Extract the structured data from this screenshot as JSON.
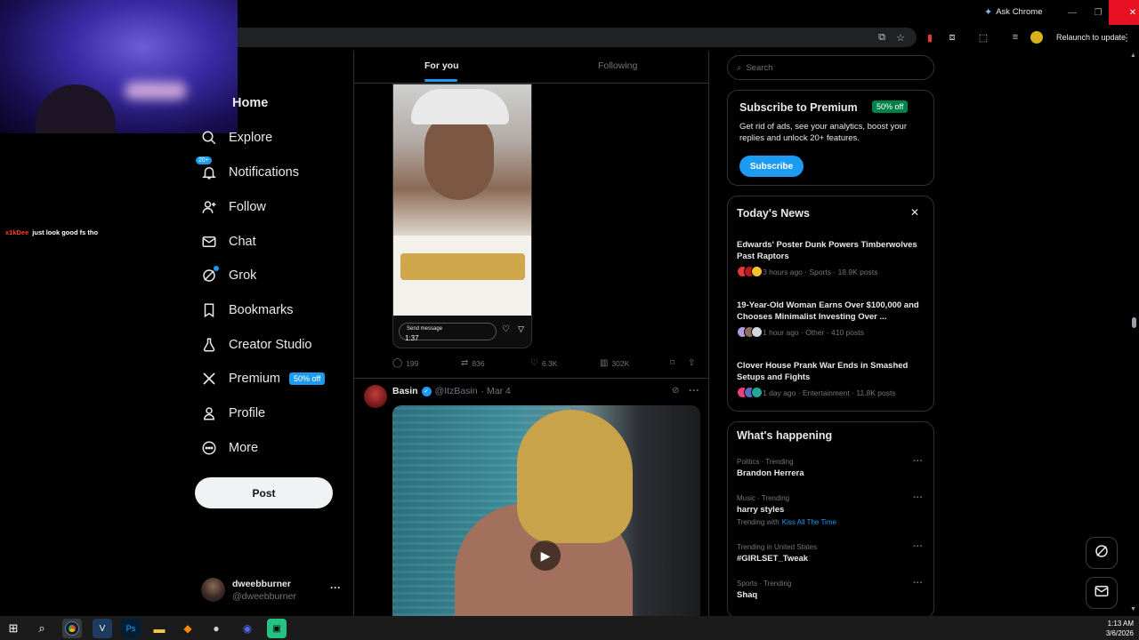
{
  "browser": {
    "ask_chrome": "Ask Chrome",
    "relaunch": "Relaunch to update",
    "window_controls": [
      "minimize-icon",
      "maximize-icon",
      "close-icon"
    ]
  },
  "stream": {
    "chat_user": "x1kDee",
    "chat_text": "just look good fs tho"
  },
  "nav": {
    "home": "Home",
    "explore": "Explore",
    "notifications": "Notifications",
    "notifications_badge": "20+",
    "follow": "Follow",
    "chat": "Chat",
    "grok": "Grok",
    "bookmarks": "Bookmarks",
    "creator_studio": "Creator Studio",
    "premium": "Premium",
    "premium_badge": "50% off",
    "profile": "Profile",
    "more": "More",
    "post_button": "Post"
  },
  "account": {
    "name": "dweebburner",
    "handle": "@dweebburner"
  },
  "feed": {
    "tabs": [
      "For you",
      "Following"
    ],
    "active_tab": "For you",
    "post1": {
      "video_message_placeholder": "Send message",
      "video_time": "1:37",
      "replies": "199",
      "reposts": "836",
      "likes": "6.3K",
      "views": "302K"
    },
    "post2": {
      "name": "Basin",
      "handle": "@ItzBasin",
      "date": "· Mar 4"
    }
  },
  "right": {
    "search_placeholder": "Search",
    "premium_card": {
      "title": "Subscribe to Premium",
      "badge": "50% off",
      "description": "Get rid of ads, see your analytics, boost your replies and unlock 20+ features.",
      "button": "Subscribe"
    },
    "news": {
      "title": "Today's News",
      "items": [
        {
          "headline": "Edwards' Poster Dunk Powers Timberwolves Past Raptors",
          "meta": "3 hours ago · Sports · 18.9K posts"
        },
        {
          "headline": "19-Year-Old Woman Earns Over $100,000 and Chooses Minimalist Investing Over ...",
          "meta": "1 hour ago · Other · 410 posts"
        },
        {
          "headline": "Clover House Prank War Ends in Smashed Setups and Fights",
          "meta": "1 day ago · Entertainment · 11.8K posts"
        }
      ]
    },
    "happening": {
      "title": "What's happening",
      "trends": [
        {
          "category": "Politics · Trending",
          "name": "Brandon Herrera"
        },
        {
          "category": "Music · Trending",
          "name": "harry styles",
          "with_label": "Trending with",
          "with_value": "Kiss All The Time"
        },
        {
          "category": "Trending in United States",
          "name": "#GIRLSET_Tweak"
        },
        {
          "category": "Sports · Trending",
          "name": "Shaq"
        }
      ]
    }
  },
  "taskbar": {
    "time": "1:13 AM",
    "date": "3/6/2026"
  },
  "colors": {
    "accent": "#1d9bf0",
    "background": "#000000",
    "border": "#2f3336",
    "muted_text": "#71767b",
    "premium_badge_green": "#00814a"
  }
}
